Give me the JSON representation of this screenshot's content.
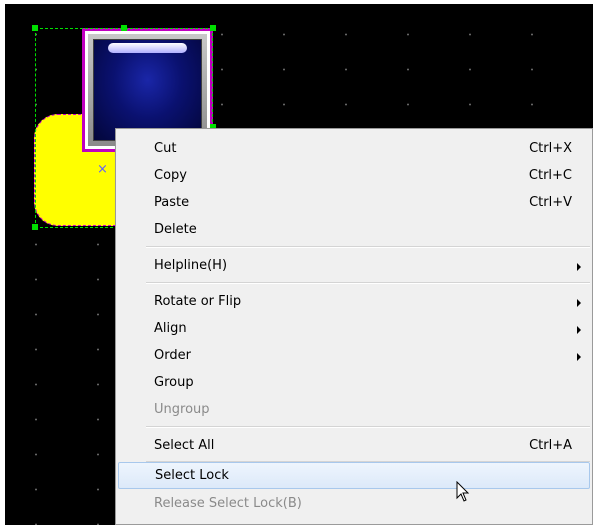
{
  "menu": {
    "items": [
      {
        "label": "Cut",
        "shortcut": "Ctrl+X",
        "submenu": false,
        "disabled": false,
        "highlighted": false
      },
      {
        "label": "Copy",
        "shortcut": "Ctrl+C",
        "submenu": false,
        "disabled": false,
        "highlighted": false
      },
      {
        "label": "Paste",
        "shortcut": "Ctrl+V",
        "submenu": false,
        "disabled": false,
        "highlighted": false
      },
      {
        "label": "Delete",
        "shortcut": "",
        "submenu": false,
        "disabled": false,
        "highlighted": false
      },
      {
        "label": "Helpline(H)",
        "shortcut": "",
        "submenu": true,
        "disabled": false,
        "highlighted": false
      },
      {
        "label": "Rotate or Flip",
        "shortcut": "",
        "submenu": true,
        "disabled": false,
        "highlighted": false
      },
      {
        "label": "Align",
        "shortcut": "",
        "submenu": true,
        "disabled": false,
        "highlighted": false
      },
      {
        "label": "Order",
        "shortcut": "",
        "submenu": true,
        "disabled": false,
        "highlighted": false
      },
      {
        "label": "Group",
        "shortcut": "",
        "submenu": false,
        "disabled": false,
        "highlighted": false
      },
      {
        "label": "Ungroup",
        "shortcut": "",
        "submenu": false,
        "disabled": true,
        "highlighted": false
      },
      {
        "label": "Select All",
        "shortcut": "Ctrl+A",
        "submenu": false,
        "disabled": false,
        "highlighted": false
      },
      {
        "label": "Select Lock",
        "shortcut": "",
        "submenu": false,
        "disabled": false,
        "highlighted": true
      },
      {
        "label": "Release Select Lock(B)",
        "shortcut": "",
        "submenu": false,
        "disabled": true,
        "highlighted": false
      }
    ]
  },
  "canvas": {
    "background": "#000000",
    "shapes": [
      "yellow-rounded-rectangle",
      "blue-window-panel"
    ],
    "center_marker": "×"
  },
  "colors": {
    "selection": "#00e000",
    "shape_outline": "#c000c0",
    "yellow_fill": "#ffff00",
    "menu_highlight": "#dce9f9"
  }
}
